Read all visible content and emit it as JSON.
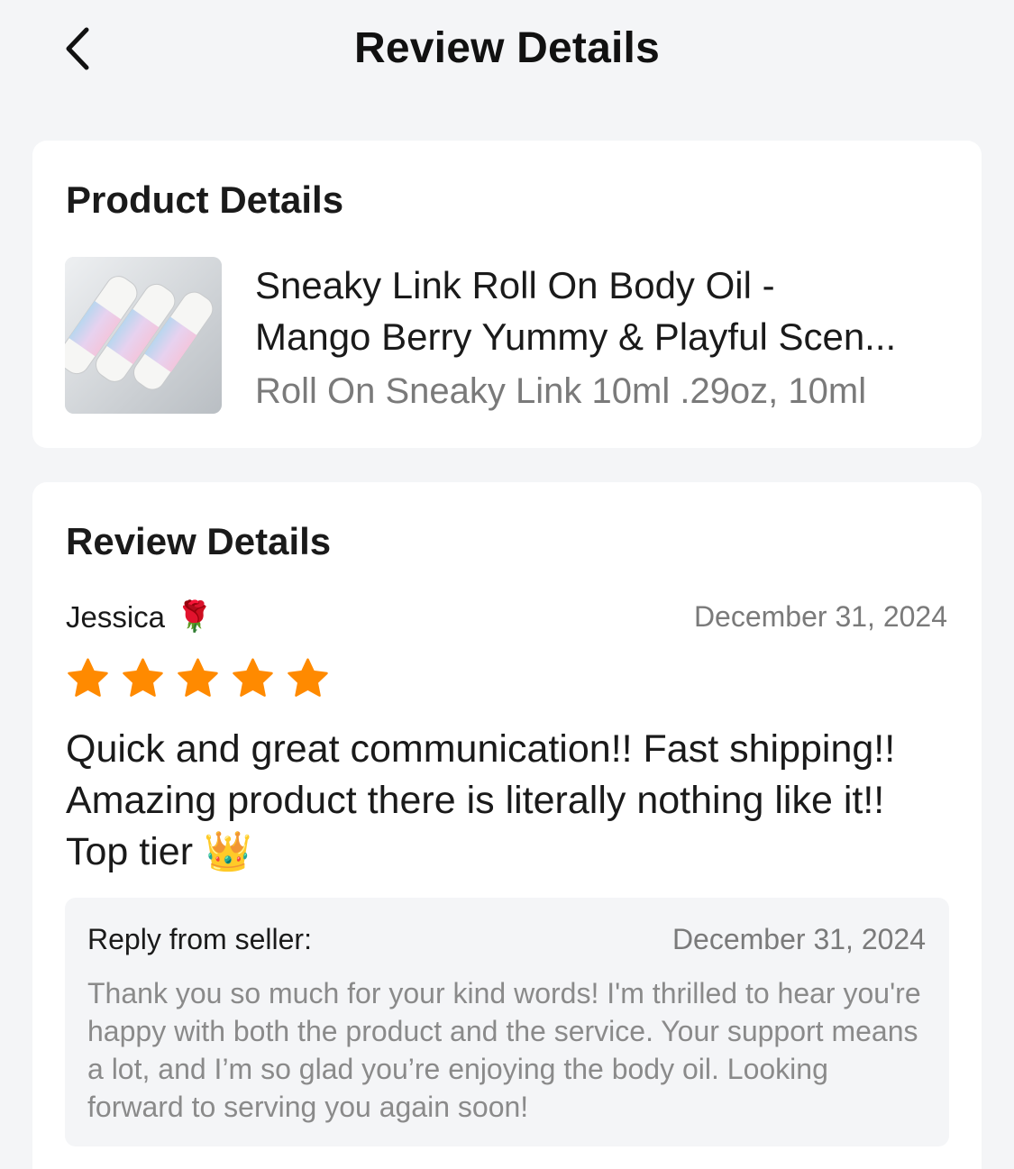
{
  "header": {
    "title": "Review Details",
    "back_icon": "chevron-left-icon"
  },
  "product_card": {
    "title": "Product Details",
    "product_name_line1": "Sneaky Link Roll On Body Oil -",
    "product_name_line2": "Mango Berry Yummy & Playful Scen...",
    "variant": "Roll On Sneaky Link 10ml .29oz, 10ml",
    "image_icon": "product-thumbnail"
  },
  "review_card": {
    "title": "Review Details",
    "reviewer_name": "Jessica",
    "reviewer_emoji": "🌹",
    "date": "December 31, 2024",
    "rating": 5,
    "rating_max": 5,
    "star_color": "#ff8a00",
    "text": "Quick and great communication!! Fast shipping!! Amazing product there is literally nothing like it!! Top tier 👑",
    "reply": {
      "label": "Reply from seller:",
      "date": "December 31, 2024",
      "text": "Thank you so much for your kind words! I'm thrilled to hear you're happy with both the product and the service. Your support means a lot, and I’m so glad you’re enjoying the body oil. Looking forward to serving you again soon!"
    }
  }
}
